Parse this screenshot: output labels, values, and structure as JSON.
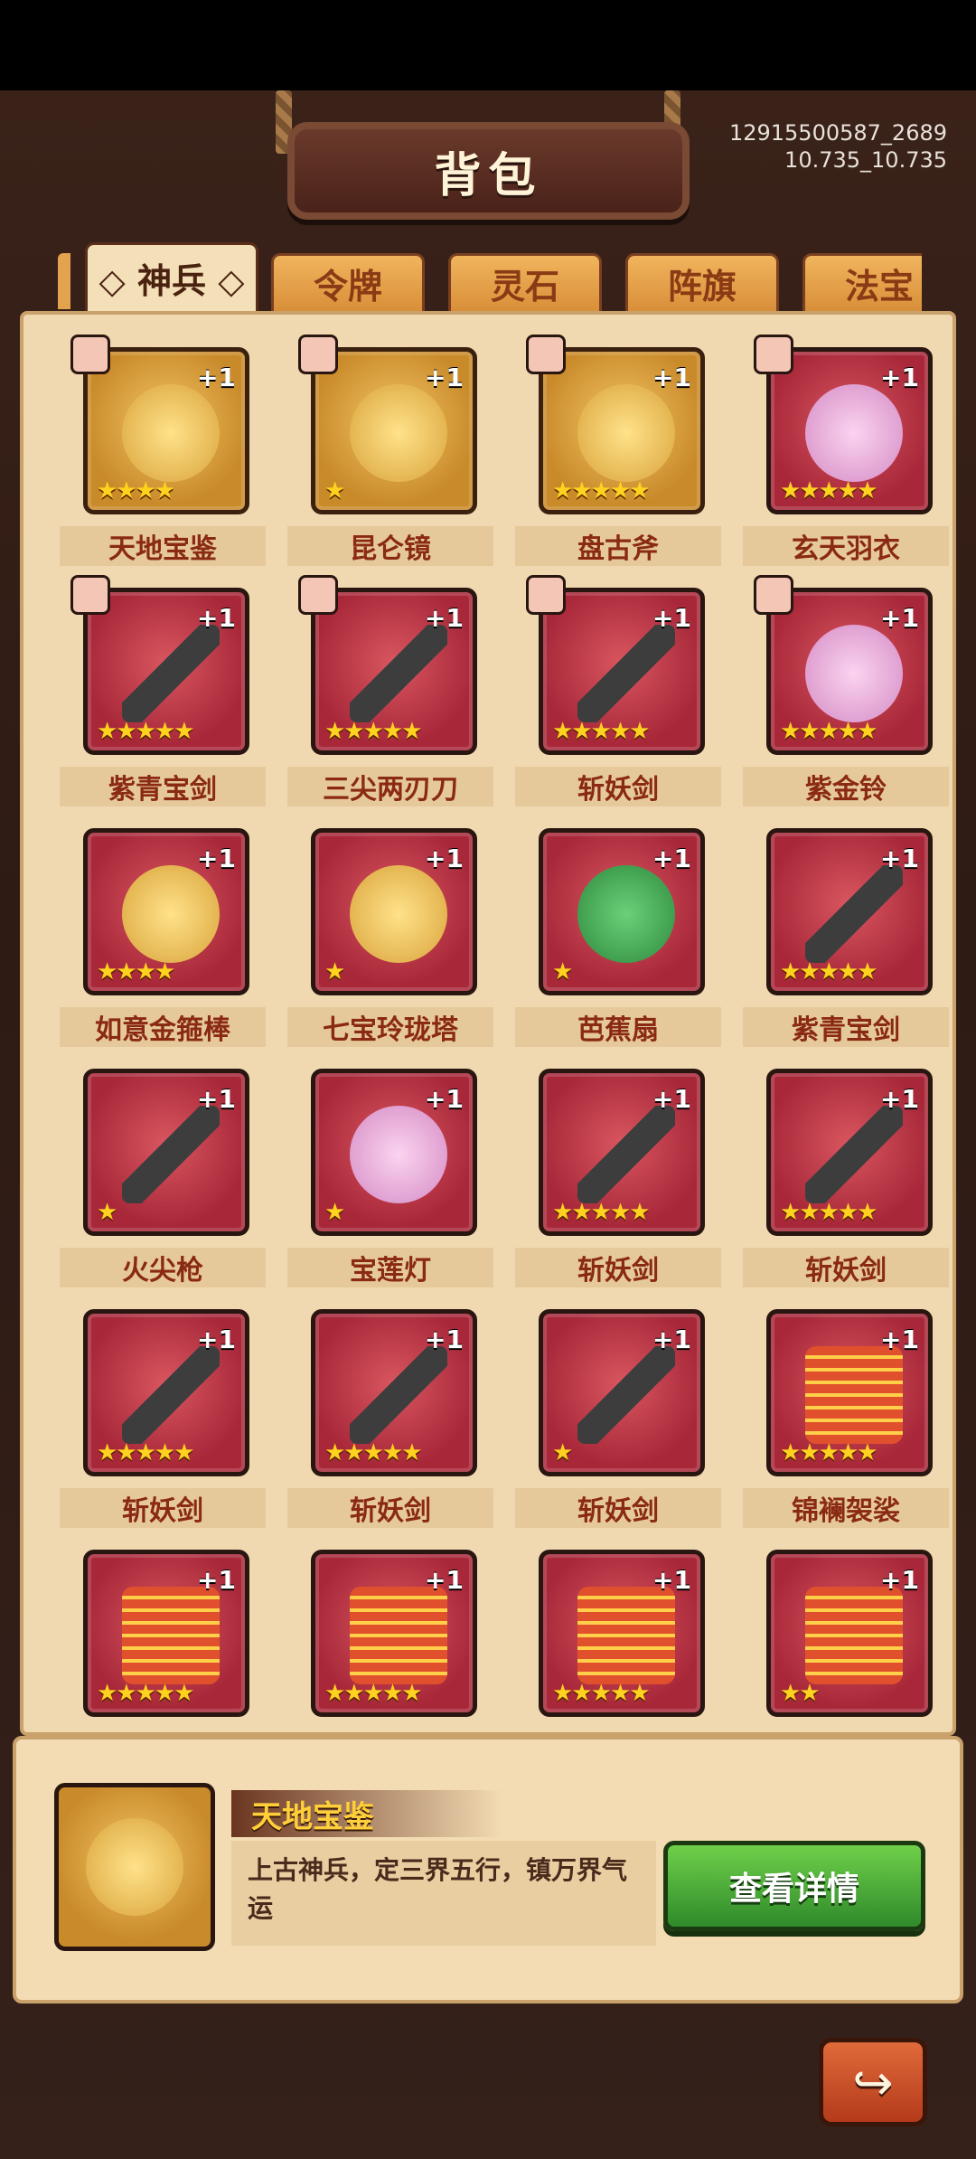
{
  "window": {
    "title": "背包"
  },
  "build_info": {
    "line1": "12915500587_2689",
    "line2": "10.735_10.735"
  },
  "tabs": [
    {
      "label": "神兵",
      "active": true,
      "display": "◇ 神兵 ◇"
    },
    {
      "label": "令牌",
      "active": false,
      "display": "令牌"
    },
    {
      "label": "灵石",
      "active": false,
      "display": "灵石"
    },
    {
      "label": "阵旗",
      "active": false,
      "display": "阵旗"
    },
    {
      "label": "法宝",
      "active": false,
      "display": "法宝"
    }
  ],
  "items": [
    {
      "name": "天地宝鉴",
      "count": "+1",
      "stars": "★★★★",
      "frame": "gold",
      "art": "yellow",
      "has_avatar": true
    },
    {
      "name": "昆仑镜",
      "count": "+1",
      "stars": "★",
      "frame": "gold",
      "art": "yellow",
      "has_avatar": true
    },
    {
      "name": "盘古斧",
      "count": "+1",
      "stars": "★★★★★",
      "frame": "gold",
      "art": "yellow",
      "has_avatar": true
    },
    {
      "name": "玄天羽衣",
      "count": "+1",
      "stars": "★★★★★",
      "frame": "red",
      "art": "pink",
      "has_avatar": true
    },
    {
      "name": "紫青宝剑",
      "count": "+1",
      "stars": "★★★★★",
      "frame": "red",
      "art": "sword",
      "has_avatar": true
    },
    {
      "name": "三尖两刃刀",
      "count": "+1",
      "stars": "★★★★★",
      "frame": "red",
      "art": "sword",
      "has_avatar": true
    },
    {
      "name": "斩妖剑",
      "count": "+1",
      "stars": "★★★★★",
      "frame": "red",
      "art": "sword",
      "has_avatar": true
    },
    {
      "name": "紫金铃",
      "count": "+1",
      "stars": "★★★★★",
      "frame": "red",
      "art": "pink",
      "has_avatar": true
    },
    {
      "name": "如意金箍棒",
      "count": "+1",
      "stars": "★★★★",
      "frame": "red",
      "art": "yellow",
      "has_avatar": false
    },
    {
      "name": "七宝玲珑塔",
      "count": "+1",
      "stars": "★",
      "frame": "red",
      "art": "yellow",
      "has_avatar": false
    },
    {
      "name": "芭蕉扇",
      "count": "+1",
      "stars": "★",
      "frame": "red",
      "art": "fan",
      "has_avatar": false
    },
    {
      "name": "紫青宝剑",
      "count": "+1",
      "stars": "★★★★★",
      "frame": "red",
      "art": "sword",
      "has_avatar": false
    },
    {
      "name": "火尖枪",
      "count": "+1",
      "stars": "★",
      "frame": "red",
      "art": "sword",
      "has_avatar": false
    },
    {
      "name": "宝莲灯",
      "count": "+1",
      "stars": "★",
      "frame": "red",
      "art": "pink",
      "has_avatar": false
    },
    {
      "name": "斩妖剑",
      "count": "+1",
      "stars": "★★★★★",
      "frame": "red",
      "art": "sword",
      "has_avatar": false
    },
    {
      "name": "斩妖剑",
      "count": "+1",
      "stars": "★★★★★",
      "frame": "red",
      "art": "sword",
      "has_avatar": false
    },
    {
      "name": "斩妖剑",
      "count": "+1",
      "stars": "★★★★★",
      "frame": "red",
      "art": "sword",
      "has_avatar": false
    },
    {
      "name": "斩妖剑",
      "count": "+1",
      "stars": "★★★★★",
      "frame": "red",
      "art": "sword",
      "has_avatar": false
    },
    {
      "name": "斩妖剑",
      "count": "+1",
      "stars": "★",
      "frame": "red",
      "art": "sword",
      "has_avatar": false
    },
    {
      "name": "锦襕袈裟",
      "count": "+1",
      "stars": "★★★★★",
      "frame": "red",
      "art": "cloth",
      "has_avatar": false
    },
    {
      "name": "",
      "count": "+1",
      "stars": "★★★★★",
      "frame": "red",
      "art": "cloth",
      "has_avatar": false
    },
    {
      "name": "",
      "count": "+1",
      "stars": "★★★★★",
      "frame": "red",
      "art": "cloth",
      "has_avatar": false
    },
    {
      "name": "",
      "count": "+1",
      "stars": "★★★★★",
      "frame": "red",
      "art": "cloth",
      "has_avatar": false
    },
    {
      "name": "",
      "count": "+1",
      "stars": "★★",
      "frame": "red",
      "art": "cloth",
      "has_avatar": false
    }
  ],
  "detail": {
    "name": "天地宝鉴",
    "description": "上古神兵，定三界五行，镇万界气运",
    "button_label": "查看详情"
  },
  "back_button": {
    "icon": "return-arrow-icon",
    "glyph": "↪"
  },
  "colors": {
    "gold_frame": "#c98a2a",
    "red_frame": "#a8283a",
    "star": "#ffd21f",
    "name_text": "#8a2a14",
    "button_green": "#2f8a2a"
  }
}
